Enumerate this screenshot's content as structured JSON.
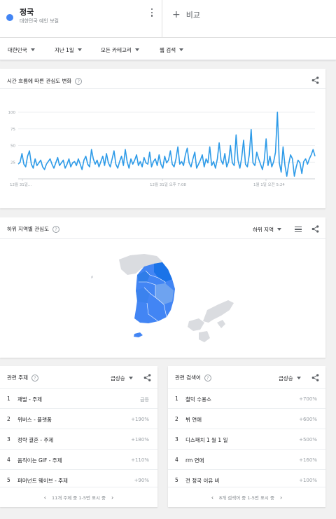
{
  "term": {
    "name": "정국",
    "subtitle": "대한민국 예인 보컬"
  },
  "compare": {
    "label": "비교",
    "plus": "+"
  },
  "filters": [
    "대한민국",
    "지난 1일",
    "모든 카테고리",
    "웹 검색"
  ],
  "interest_over_time": {
    "title": "시간 흐름에 따른 관심도 변화",
    "help": "?"
  },
  "chart_data": {
    "type": "line",
    "title": "",
    "xlabel": "",
    "ylabel": "",
    "ylim": [
      0,
      100
    ],
    "yticks": [
      25,
      50,
      75,
      100
    ],
    "xtick_labels": [
      "12월 31일...",
      "12월 31일 오후 7:08",
      "1월 1일 오전 5:24"
    ],
    "grid": true,
    "color": "#2e9be8",
    "values": [
      22,
      25,
      38,
      22,
      18,
      34,
      42,
      22,
      16,
      30,
      20,
      24,
      28,
      18,
      14,
      22,
      26,
      30,
      22,
      16,
      24,
      32,
      20,
      24,
      28,
      16,
      22,
      30,
      18,
      24,
      26,
      20,
      30,
      22,
      14,
      28,
      34,
      22,
      18,
      44,
      30,
      22,
      28,
      18,
      26,
      34,
      20,
      38,
      24,
      18,
      30,
      42,
      22,
      16,
      26,
      34,
      20,
      44,
      26,
      16,
      30,
      22,
      28,
      36,
      20,
      26,
      18,
      32,
      24,
      22,
      40,
      18,
      26,
      30,
      20,
      36,
      22,
      16,
      34,
      24,
      28,
      42,
      22,
      18,
      30,
      48,
      22,
      26,
      20,
      36,
      46,
      24,
      18,
      30,
      40,
      16,
      22,
      28,
      36,
      18,
      30,
      24,
      48,
      20,
      26,
      16,
      30,
      54,
      28,
      22,
      38,
      18,
      26,
      50,
      24,
      20,
      66,
      28,
      16,
      32,
      58,
      22,
      18,
      36,
      74,
      24,
      20,
      40,
      30,
      22,
      14,
      28,
      60,
      20,
      34,
      18,
      26,
      40,
      100,
      24,
      10,
      48,
      20,
      4,
      22,
      36,
      30,
      4,
      18,
      28,
      24,
      8,
      26,
      30,
      22,
      30,
      36,
      44,
      34
    ]
  },
  "subregion": {
    "title": "하위 지역별 관심도",
    "help": "?",
    "dropdown_label": "하위 지역",
    "map_colors": {
      "high": "#1a73e8",
      "mid": "#4285f4",
      "light": "#6ea3f0",
      "neutral": "#dadce0"
    }
  },
  "related_topics": {
    "title": "관련 주제",
    "help": "?",
    "sort_label": "급상승",
    "items": [
      {
        "rank": "1",
        "label": "재벌 - 주제",
        "value": "급등"
      },
      {
        "rank": "2",
        "label": "위버스 - 플랫폼",
        "value": "+190%"
      },
      {
        "rank": "3",
        "label": "정략 결혼 - 주제",
        "value": "+180%"
      },
      {
        "rank": "4",
        "label": "움직이는 GIF - 주제",
        "value": "+110%"
      },
      {
        "rank": "5",
        "label": "퍼머넌트 웨이브 - 주제",
        "value": "+90%"
      }
    ],
    "pager": "11개 주제 중 1-5번 표시 중",
    "prev": "‹",
    "next": "›"
  },
  "related_queries": {
    "title": "관련 검색어",
    "help": "?",
    "sort_label": "급상승",
    "items": [
      {
        "rank": "1",
        "label": "철덕 수용소",
        "value": "+700%"
      },
      {
        "rank": "2",
        "label": "뷔 연애",
        "value": "+600%"
      },
      {
        "rank": "3",
        "label": "디스패치 1 월 1 일",
        "value": "+500%"
      },
      {
        "rank": "4",
        "label": "rm 연애",
        "value": "+160%"
      },
      {
        "rank": "5",
        "label": "전 정국 이유 비",
        "value": "+100%"
      }
    ],
    "pager": "8개 검색어 중 1-5번 표시 중",
    "prev": "‹",
    "next": "›"
  }
}
